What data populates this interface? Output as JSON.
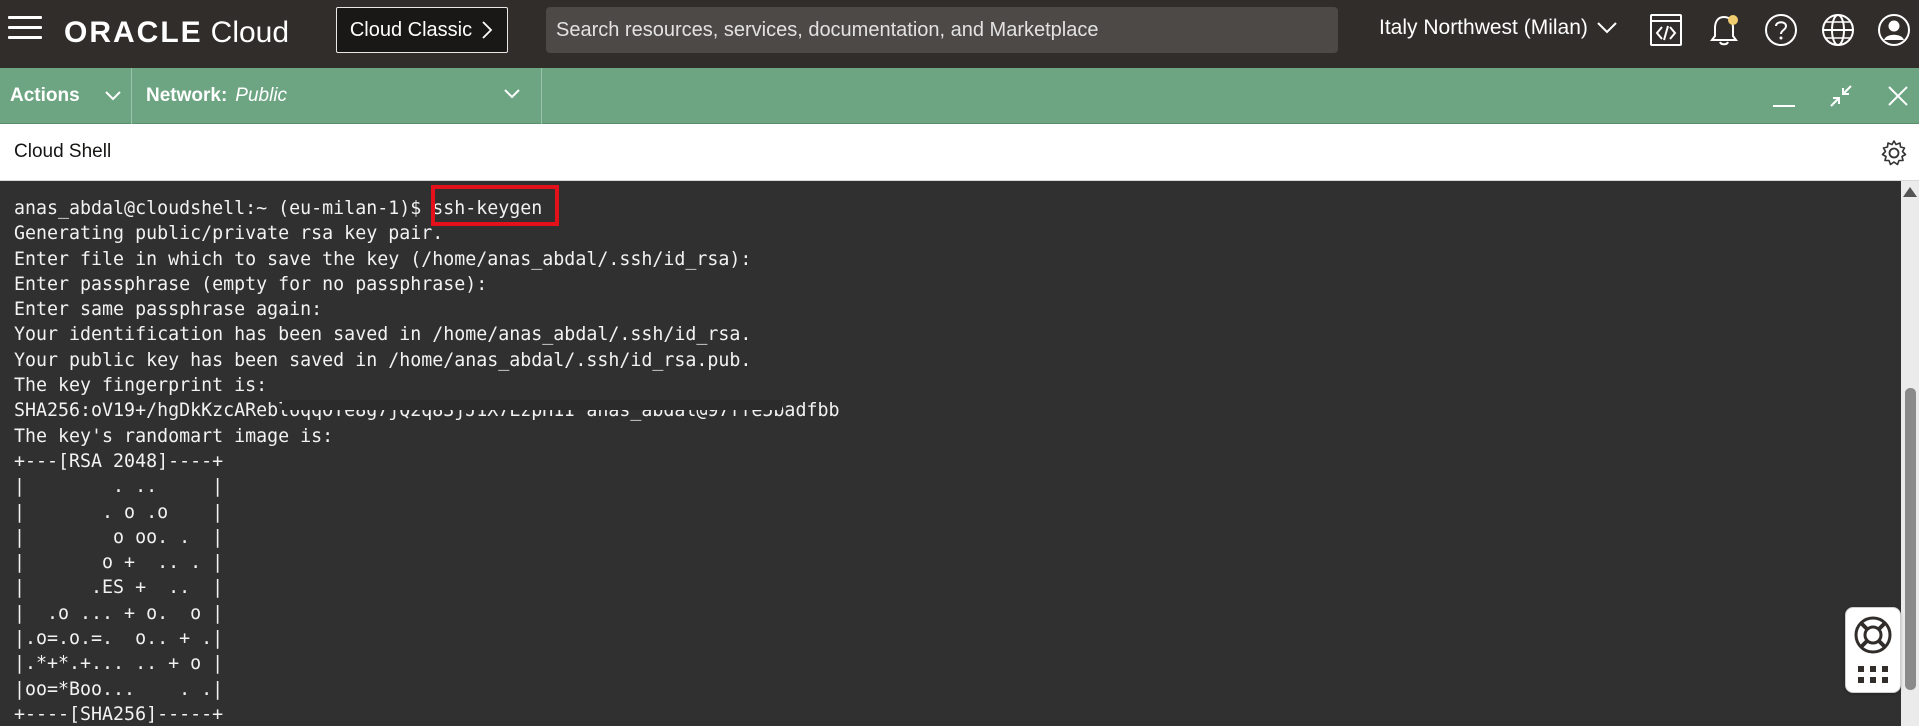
{
  "header": {
    "logo_brand": "ORACLE",
    "logo_product": "Cloud",
    "classic_button_label": "Cloud Classic",
    "search_placeholder": "Search resources, services, documentation, and Marketplace",
    "region_label": "Italy Northwest (Milan)",
    "icons": [
      "menu-icon",
      "code-editor-icon",
      "notification-bell-icon",
      "help-icon",
      "language-globe-icon",
      "profile-icon"
    ],
    "notification_dot_color": "#f0cc71"
  },
  "actionbar": {
    "actions_label": "Actions",
    "network_label": "Network:",
    "network_value": "Public",
    "background_color": "#6da583"
  },
  "shell": {
    "title": "Cloud Shell"
  },
  "terminal": {
    "prompt": "anas_abdal@cloudshell:~ (eu-milan-1)$ ",
    "command": "ssh-keygen",
    "output_lines": [
      "Generating public/private rsa key pair.",
      "Enter file in which to save the key (/home/anas_abdal/.ssh/id_rsa):",
      "Enter passphrase (empty for no passphrase):",
      "Enter same passphrase again:",
      "Your identification has been saved in /home/anas_abdal/.ssh/id_rsa.",
      "Your public key has been saved in /home/anas_abdal/.ssh/id_rsa.pub.",
      "The key fingerprint is:",
      "SHA256:oV19+/hgDkKzcARebl6qqOTe8g7jQ2q83jJ1X7LzpH1I anas_abdal@97ffe5badfbb",
      "The key's randomart image is:",
      "+---[RSA 2048]----+",
      "|        . ..     |",
      "|       . o .o    |",
      "|        o oo. .  |",
      "|       o +  .. . |",
      "|      .ES +  ..  |",
      "|  .o ... + o.  o |",
      "|.o=.o.=.  o.. + .|",
      "|.*+*.+... .. + o |",
      "|oo=*Boo...    . .|",
      "+----[SHA256]-----+"
    ],
    "highlight_color": "#e4101a",
    "background_color": "#303030"
  }
}
